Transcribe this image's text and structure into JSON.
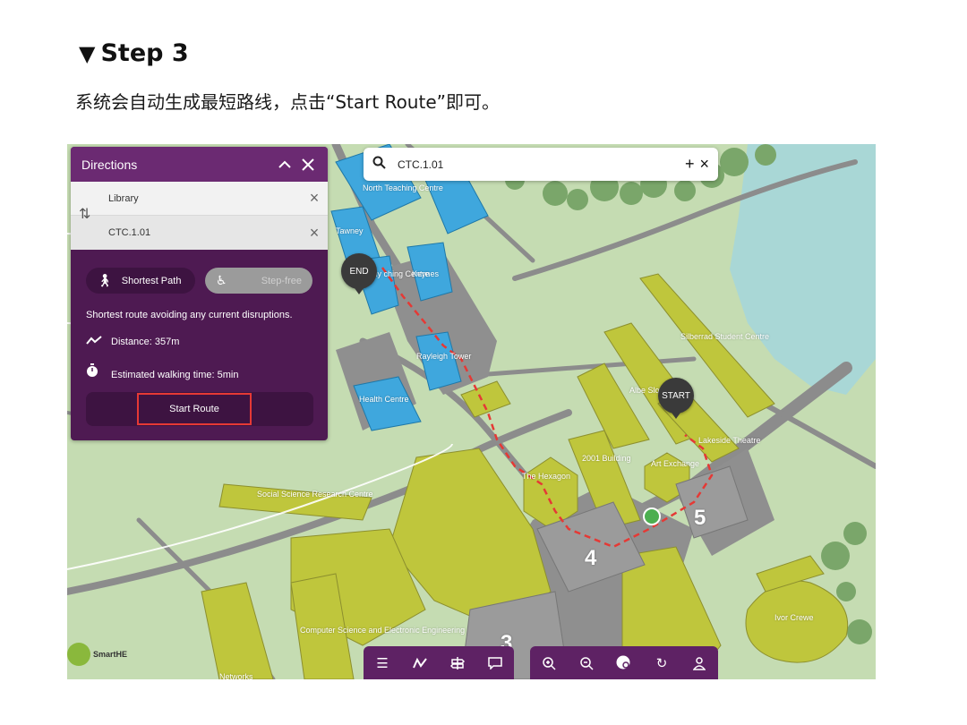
{
  "header": {
    "step_marker": "▼",
    "step_title": "Step 3",
    "description": "系统会自动生成最短路线，点击“Start Route”即可。"
  },
  "directions": {
    "title": "Directions",
    "collapse_icon": "chevron-up-icon",
    "close_icon": "close-icon",
    "from": "Library",
    "to": "CTC.1.01",
    "mode_shortest": "Shortest Path",
    "mode_stepfree": "Step-free",
    "info": "Shortest route avoiding any current disruptions.",
    "distance": "Distance: 357m",
    "time": "Estimated walking time: 5min",
    "start_route": "Start Route"
  },
  "search": {
    "value": "CTC.1.01"
  },
  "markers": {
    "end": "END",
    "start": "START"
  },
  "map_labels": {
    "north_teaching": "North Teaching Centre",
    "tawney": "Tawney",
    "keynes": "Keynes",
    "teaching": "eway ching Centre",
    "rayleigh": "Rayleigh Tower",
    "health": "Health Centre",
    "silberrad": "Silberrad Student Centre",
    "albert": "Albe Slom Library",
    "lakeside": "Lakeside Theatre",
    "building_2001": "2001 Building",
    "art_exchange": "Art Exchange",
    "hexagon": "The Hexagon",
    "social_science": "Social Science Research Centre",
    "computer_science": "Computer Science and Electronic Engineering",
    "networks": "Networks",
    "ivor_crewe": "Ivor Crewe",
    "square_4": "4",
    "square_5": "5",
    "square_3": "3"
  },
  "logo_text": "SmartHE",
  "colors": {
    "panel": "#4e1a52",
    "panel_header": "#6b2a72",
    "building": "#bfc63c",
    "building_blue": "#3fa7dd",
    "route": "#e53935",
    "water": "#a9d7d6",
    "grass": "#c5dcb2"
  }
}
